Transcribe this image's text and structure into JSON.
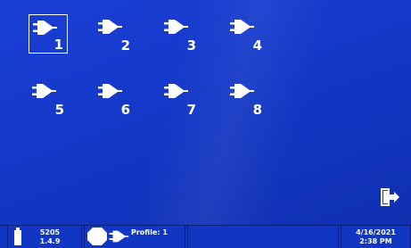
{
  "tiles": [
    {
      "number": "1",
      "selected": true
    },
    {
      "number": "2",
      "selected": false
    },
    {
      "number": "3",
      "selected": false
    },
    {
      "number": "4",
      "selected": false
    },
    {
      "number": "5",
      "selected": false
    },
    {
      "number": "6",
      "selected": false
    },
    {
      "number": "7",
      "selected": false
    },
    {
      "number": "8",
      "selected": false
    }
  ],
  "tile_icon": "plug-icon",
  "exit_icon": "exit-door-icon",
  "status": {
    "device_model": "5205",
    "firmware_version": "1.4.9",
    "profile_label": "Profile: 1",
    "date": "4/16/2021",
    "time": "2:38 PM"
  },
  "colors": {
    "background": "#1438c8",
    "foreground": "#ffffff",
    "statusbar": "#1236c4"
  }
}
